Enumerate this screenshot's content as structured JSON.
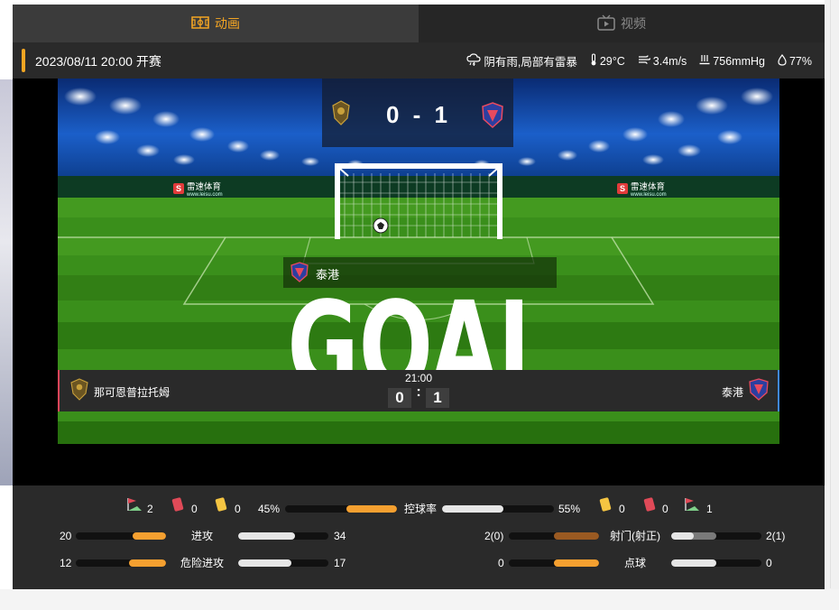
{
  "tabs": [
    {
      "label": "动画",
      "icon": "pitch-icon",
      "active": true
    },
    {
      "label": "视频",
      "icon": "video-icon",
      "active": false
    }
  ],
  "match": {
    "datetime": "2023/08/11 20:00 开赛",
    "minute": "21:00",
    "home": {
      "name": "那可恩普拉托姆",
      "score": "0"
    },
    "away": {
      "name": "泰港",
      "score": "1"
    },
    "score_display": "0 - 1"
  },
  "weather": {
    "condition": "阴有雨,局部有雷暴",
    "temperature": "29°C",
    "wind": "3.4m/s",
    "pressure": "756mmHg",
    "humidity": "77%"
  },
  "animation": {
    "event_team": "泰港",
    "event_text": "GOAL",
    "sponsor": "雷速体育",
    "sponsor_url": "www.leisu.com"
  },
  "stats": {
    "home_corners": "2",
    "home_red": "0",
    "home_yellow": "0",
    "away_yellow": "0",
    "away_red": "0",
    "away_corners": "1",
    "possession": {
      "label": "控球率",
      "home": "45%",
      "away": "55%",
      "home_pct": 45,
      "away_pct": 55
    },
    "attacks": {
      "label": "进攻",
      "home": "20",
      "away": "34"
    },
    "dangerous_attacks": {
      "label": "危险进攻",
      "home": "12",
      "away": "17"
    },
    "shots": {
      "label": "射门(射正)",
      "home": "2(0)",
      "away": "2(1)"
    },
    "penalties": {
      "label": "点球",
      "home": "0",
      "away": "0"
    }
  },
  "colors": {
    "accent": "#f5a623",
    "home_line": "#e0455a",
    "away_line": "#3f88e0",
    "background": "#2a2a2a"
  }
}
